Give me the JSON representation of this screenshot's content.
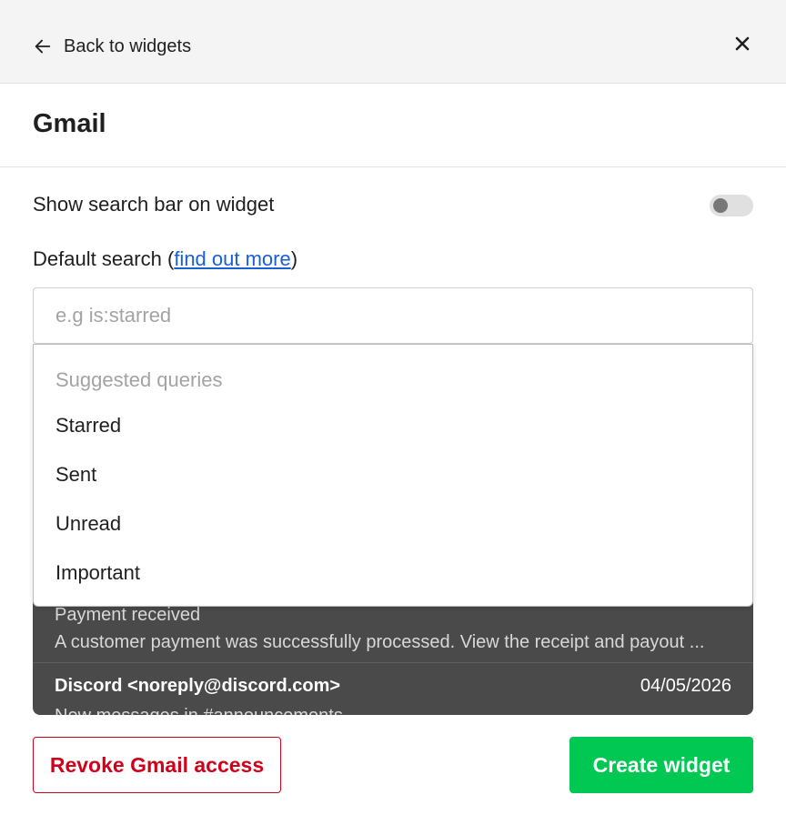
{
  "header": {
    "back_label": "Back to widgets",
    "back_icon": "arrow-left-icon",
    "close_icon": "close-icon"
  },
  "title": "Gmail",
  "settings": {
    "search_bar_label": "Show search bar on widget",
    "search_bar_enabled": false,
    "default_search_label": "Default search",
    "default_search_open": "(",
    "default_search_link": "find out more",
    "default_search_close": ")",
    "search_value": "",
    "search_placeholder": "e.g is:starred"
  },
  "dropdown": {
    "header": "Suggested queries",
    "options": [
      "Starred",
      "Sent",
      "Unread",
      "Important"
    ]
  },
  "preview": {
    "emails": [
      {
        "subject": "Payment received",
        "snippet": "A customer payment was successfully processed. View the receipt and payout ..."
      },
      {
        "sender": "Discord <noreply@discord.com>",
        "date": "04/05/2026",
        "snippet": "New messages in #announcements"
      }
    ]
  },
  "actions": {
    "revoke_label": "Revoke Gmail access",
    "create_label": "Create widget"
  },
  "colors": {
    "link": "#1a5fd6",
    "danger": "#d0021b",
    "primary": "#00c853",
    "preview_bg": "#4a4a4a"
  }
}
